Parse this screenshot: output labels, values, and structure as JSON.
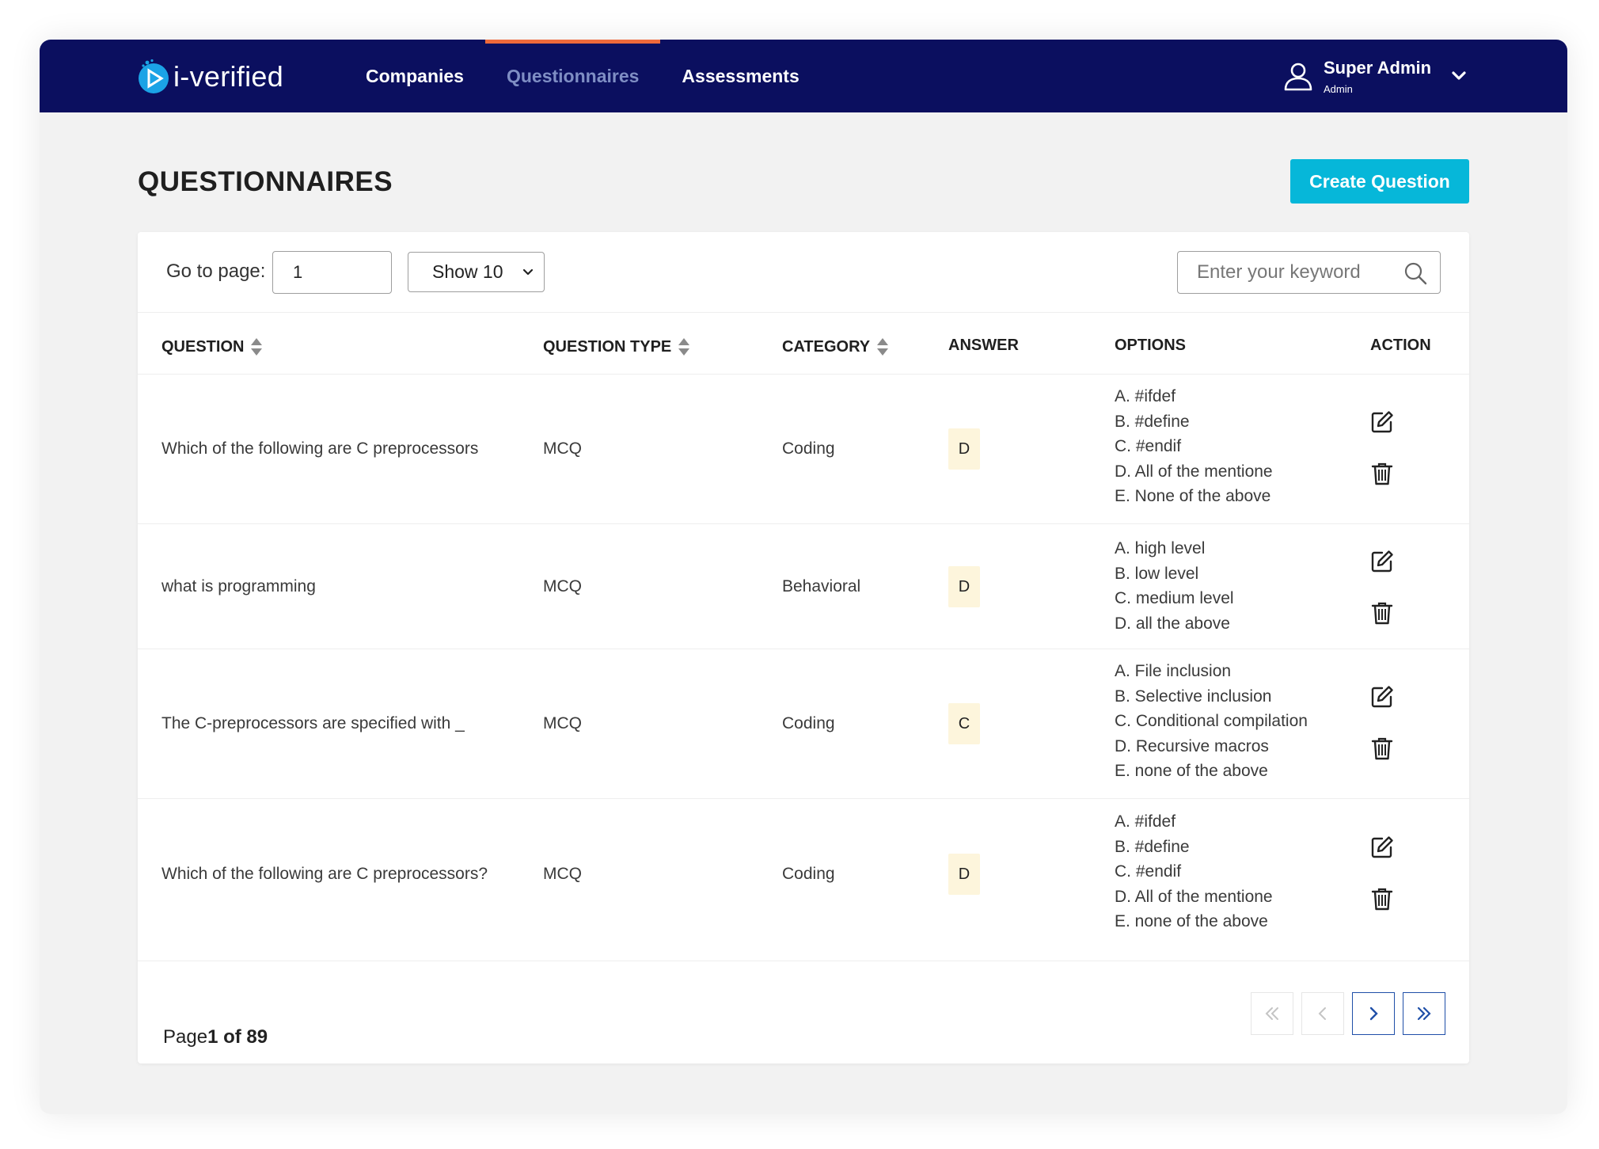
{
  "brand": {
    "name": "i-verified",
    "logo_color": "#1ba3e6"
  },
  "nav": {
    "tabs": [
      {
        "label": "Companies",
        "active": false
      },
      {
        "label": "Questionnaires",
        "active": true
      },
      {
        "label": "Assessments",
        "active": false
      }
    ],
    "active_indicator_color": "#ef6a3b",
    "background": "#0b0f5f"
  },
  "user": {
    "name": "Super Admin",
    "role": "Admin",
    "icon": "user-icon",
    "menu_icon": "chevron-down-icon"
  },
  "page": {
    "title": "QUESTIONNAIRES",
    "create_button": "Create Question"
  },
  "toolbar": {
    "goto_label": "Go to page:",
    "goto_value": "1",
    "page_size": "Show 10",
    "search_placeholder": "Enter your keyword",
    "search_icon": "search-icon"
  },
  "table": {
    "headers": {
      "question": "QUESTION",
      "question_type": "QUESTION TYPE",
      "category": "CATEGORY",
      "answer": "ANSWER",
      "options": "OPTIONS",
      "action": "ACTION"
    },
    "sortable": [
      "question",
      "question_type",
      "category"
    ],
    "rows": [
      {
        "question": "Which of the following are C preprocessors",
        "type": "MCQ",
        "category": "Coding",
        "answer": "D",
        "options": [
          "A. #ifdef",
          "B. #define",
          "C. #endif",
          "D. All of the mentione",
          "E. None of the above"
        ]
      },
      {
        "question": "what is programming",
        "type": "MCQ",
        "category": "Behavioral",
        "answer": "D",
        "options": [
          "A. high level",
          "B. low level",
          "C. medium level",
          "D. all the above"
        ]
      },
      {
        "question": "The C-preprocessors are specified with _",
        "type": "MCQ",
        "category": "Coding",
        "answer": "C",
        "options": [
          "A. File inclusion",
          "B. Selective inclusion",
          "C. Conditional compilation",
          "D. Recursive macros",
          "E. none of the above"
        ]
      },
      {
        "question": "Which of the following are C preprocessors?",
        "type": "MCQ",
        "category": "Coding",
        "answer": "D",
        "options": [
          "A. #ifdef",
          "B. #define",
          "C. #endif",
          "D. All of the mentione",
          "E. none of the above"
        ]
      }
    ],
    "action_icons": [
      "edit-icon",
      "trash-icon"
    ]
  },
  "pagination": {
    "page_label": "Page",
    "current": "1",
    "of_label": "of",
    "total": "89",
    "buttons": [
      "first-page",
      "previous-page",
      "next-page",
      "last-page"
    ]
  },
  "colors": {
    "accent": "#06b7d9",
    "answer_badge": "#fdf5dc",
    "pager_border": "#1f4fa8"
  }
}
